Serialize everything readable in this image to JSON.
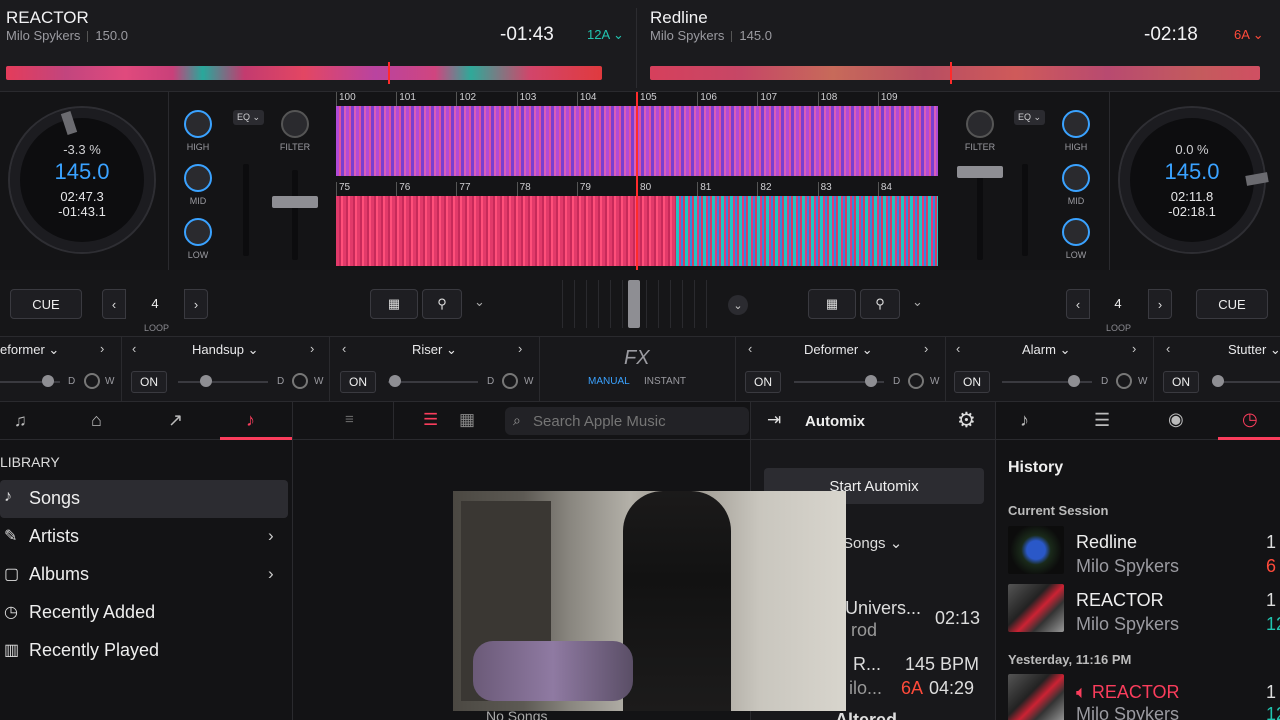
{
  "deck_left": {
    "title": "REACTOR",
    "artist": "Milo Spykers",
    "bpm": "150.0",
    "remaining": "-01:43",
    "key": "12A",
    "pitch": "-3.3 %",
    "tempo": "145.0",
    "elapsed": "02:47.3",
    "remain_time": "-01:43.1",
    "loop": "4",
    "cue": "CUE",
    "loop_label": "LOOP",
    "key_color": "#21c4b0"
  },
  "deck_right": {
    "title": "Redline",
    "artist": "Milo Spykers",
    "bpm": "145.0",
    "remaining": "-02:18",
    "key": "6A",
    "pitch": "0.0 %",
    "tempo": "145.0",
    "elapsed": "02:11.8",
    "remain_time": "-02:18.1",
    "loop": "4",
    "cue": "CUE",
    "loop_label": "LOOP",
    "key_color": "#ff4a3a"
  },
  "mixer": {
    "high": "HIGH",
    "mid": "MID",
    "low": "LOW",
    "filter": "FILTER",
    "eq": "EQ"
  },
  "beat_markers_top": [
    "100",
    "101",
    "102",
    "103",
    "104",
    "105",
    "106",
    "107",
    "108",
    "109"
  ],
  "beat_markers_bottom": [
    "75",
    "76",
    "77",
    "78",
    "79",
    "80",
    "81",
    "82",
    "83",
    "84"
  ],
  "fx": {
    "left": [
      {
        "name": "Deformer",
        "partial": "eformer",
        "on": "ON"
      },
      {
        "name": "Handsup",
        "on": "ON"
      },
      {
        "name": "Riser",
        "on": "ON"
      }
    ],
    "right": [
      {
        "name": "Deformer",
        "on": "ON"
      },
      {
        "name": "Alarm",
        "on": "ON"
      },
      {
        "name": "Stutter",
        "on": "ON"
      }
    ],
    "center_label": "FX",
    "manual": "MANUAL",
    "instant": "INSTANT",
    "d": "D",
    "w": "W"
  },
  "library": {
    "header": "LIBRARY",
    "items": [
      {
        "label": "Songs",
        "icon": "note-icon"
      },
      {
        "label": "Artists",
        "icon": "mic-icon"
      },
      {
        "label": "Albums",
        "icon": "album-icon"
      },
      {
        "label": "Recently Added",
        "icon": "clock-icon"
      },
      {
        "label": "Recently Played",
        "icon": "bars-icon"
      }
    ],
    "search_placeholder": "Search Apple Music",
    "empty": "No Songs"
  },
  "automix": {
    "title": "Automix",
    "start": "Start Automix",
    "source": "Songs",
    "rows": [
      {
        "title": "Univers...",
        "sub": "rod",
        "time": "02:13"
      },
      {
        "title": "R...",
        "sub": "ilo...",
        "bpm": "145 BPM",
        "key": "6A",
        "time": "04:29"
      },
      {
        "title": "Altered"
      }
    ]
  },
  "history": {
    "title": "History",
    "session": "Current Session",
    "yesterday": "Yesterday, 11:16 PM",
    "items": [
      {
        "title": "Redline",
        "artist": "Milo Spykers",
        "num": "1",
        "key": "6"
      },
      {
        "title": "REACTOR",
        "artist": "Milo Spykers",
        "num": "1",
        "key": "12"
      },
      {
        "title": "REACTOR",
        "artist": "Milo Spykers",
        "num": "1",
        "key": "12"
      }
    ]
  }
}
